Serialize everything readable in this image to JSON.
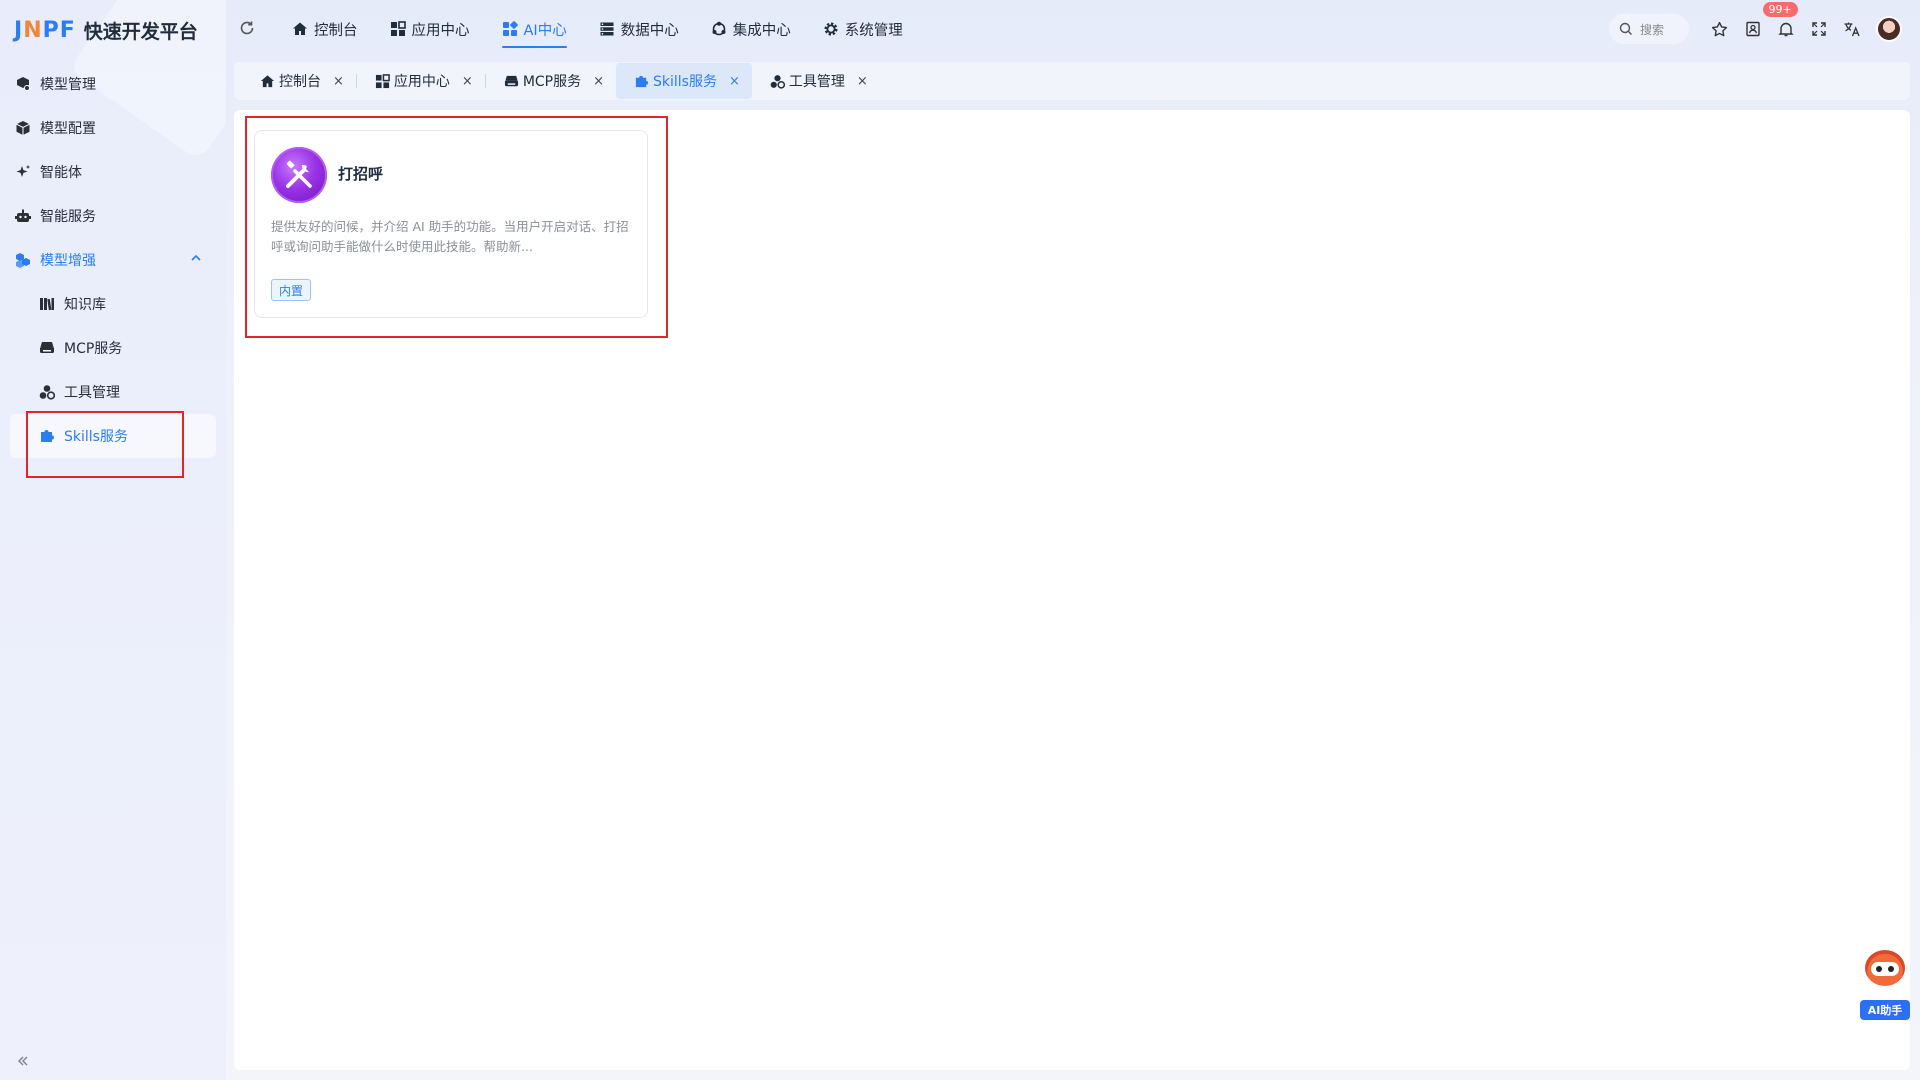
{
  "app": {
    "logo_mark_1": "J",
    "logo_mark_2": "N",
    "logo_mark_3": "PF",
    "title": "快速开发平台"
  },
  "sidebar": {
    "items": [
      {
        "label": "模型管理",
        "icon": "model-manage-icon"
      },
      {
        "label": "模型配置",
        "icon": "cube-icon"
      },
      {
        "label": "智能体",
        "icon": "sparkle-icon"
      },
      {
        "label": "智能服务",
        "icon": "robot-icon"
      },
      {
        "label": "模型增强",
        "icon": "cubes-icon",
        "expanded": true
      }
    ],
    "sub_items": [
      {
        "label": "知识库",
        "icon": "library-icon"
      },
      {
        "label": "MCP服务",
        "icon": "printer-icon"
      },
      {
        "label": "工具管理",
        "icon": "tools-icon"
      },
      {
        "label": "Skills服务",
        "icon": "puzzle-icon",
        "active": true
      }
    ]
  },
  "topnav": {
    "items": [
      {
        "label": "控制台",
        "icon": "home-icon"
      },
      {
        "label": "应用中心",
        "icon": "apps-icon"
      },
      {
        "label": "AI中心",
        "icon": "ai-grid-icon",
        "active": true
      },
      {
        "label": "数据中心",
        "icon": "database-icon"
      },
      {
        "label": "集成中心",
        "icon": "integration-icon"
      },
      {
        "label": "系统管理",
        "icon": "gear-icon"
      }
    ],
    "search_placeholder": "搜索",
    "notification_badge": "99+"
  },
  "tabs": [
    {
      "label": "控制台",
      "icon": "home-icon"
    },
    {
      "label": "应用中心",
      "icon": "apps-icon"
    },
    {
      "label": "MCP服务",
      "icon": "printer-icon"
    },
    {
      "label": "Skills服务",
      "icon": "puzzle-icon",
      "active": true
    },
    {
      "label": "工具管理",
      "icon": "tools-icon"
    }
  ],
  "tab_close": "×",
  "card": {
    "title": "打招呼",
    "description": "提供友好的问候，并介绍 AI 助手的功能。当用户开启对话、打招呼或询问助手能做什么时使用此技能。帮助新...",
    "tag": "内置"
  },
  "ai_assistant": {
    "label": "AI助手"
  },
  "colors": {
    "accent": "#2b7df0",
    "highlight": "#e0252b",
    "badge": "#f56c6c"
  }
}
